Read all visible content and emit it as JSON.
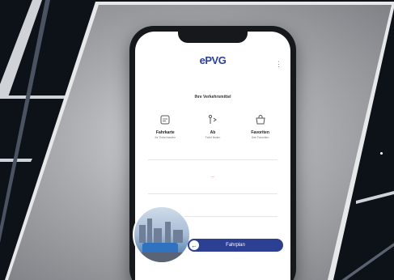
{
  "app": {
    "logo_text": "ePVG",
    "logo_tagline": "",
    "section_title": "Ihre Verkehrsmittel",
    "actions": [
      {
        "title": "Fahrkarte",
        "subtitle": "Ihr Ticket kaufen",
        "icon": "ticket-icon"
      },
      {
        "title": "Ab",
        "subtitle": "Fahrt finden",
        "icon": "route-icon"
      },
      {
        "title": "Favoriten",
        "subtitle": "Ihre Favoriten",
        "icon": "bag-icon"
      }
    ],
    "red_mark": "—",
    "row_labels": [
      "",
      "",
      ""
    ],
    "cta_label": "Fahrplan",
    "cta_arrow": "←",
    "menu_icon": "vertical-dots-icon"
  },
  "colors": {
    "brand": "#2b3f93",
    "accent_red": "#d9434b",
    "background": "#0d1118",
    "panel": "#a9abaf"
  }
}
